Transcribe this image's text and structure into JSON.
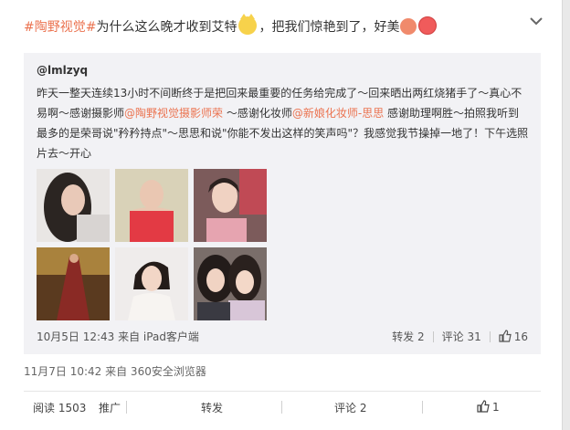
{
  "headline": {
    "topic": "#陶野视觉#",
    "text1": "为什么这么晚才收到艾特",
    "text2": "，把我们惊艳到了，好美"
  },
  "repost": {
    "user": "@lmlzyq",
    "line1": "昨天一整天连续13小时不间断终于是把回来最重要的任务给完成了～回来晒出两红烧猪手了～真心不",
    "line2_a": "易啊～感谢摄影师",
    "mention1": "@陶野视觉摄影师荣",
    "line2_b": " ～感谢化妆师",
    "mention2": "@新娘化妆师-思思",
    "line2_c": " 感谢助理啊胜～拍照我听到",
    "line3": "最多的是荣哥说\"矜矜持点\"～思思和说\"你能不发出这样的笑声吗\"？我感觉我节操掉一地了！下午选照",
    "line4": "片去～开心",
    "meta": "10月5日 12:43 来自 iPad客户端",
    "forward": "转发 2",
    "comment": "评论 31",
    "likes": "16"
  },
  "post": {
    "meta": "11月7日 10:42 来自 360安全浏览器"
  },
  "footer": {
    "reads": "阅读 1503",
    "promote": "推广",
    "forward": "转发",
    "comment": "评论 2",
    "likes": "1"
  },
  "colors": {
    "accent": "#eb7350",
    "repost_bg": "#f2f2f5"
  },
  "icons": {
    "expand": "chevron-down-icon",
    "like": "thumbs-up-icon"
  }
}
